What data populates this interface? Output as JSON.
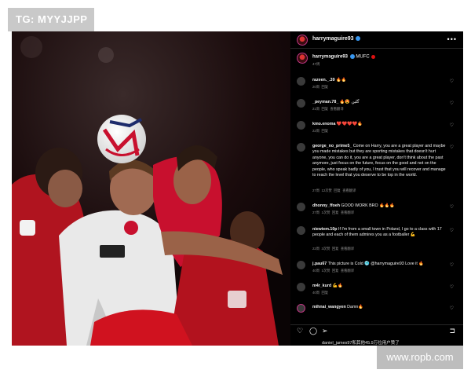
{
  "watermark_top": "TG: MYYJJPP",
  "watermark_bottom": "www.ropb.com",
  "header": {
    "username": "harrymaguire93"
  },
  "caption": {
    "username": "harrymaguire93",
    "text": "MUFC",
    "time": "47周"
  },
  "comments": [
    {
      "username": "razeen._.39",
      "text": "🔥🔥",
      "time": "20周",
      "actions": [
        "回复"
      ]
    },
    {
      "username": "_peyman.78_",
      "text": "🔥😍 گلین",
      "time": "21周",
      "actions": [
        "回复",
        "查看翻译"
      ]
    },
    {
      "username": "kmo.enoma",
      "text": "❤️❤️❤️❤️🔥",
      "time": "22周",
      "actions": [
        "回复"
      ]
    },
    {
      "username": "george_no_prime5_",
      "text": "Come on Harry, you are a great player and maybe you made mistakes but they are sporting mistakes that doesn't hurt anyone, you can do it, you are a great player, don't think about the past anymore, just focus on the future, focus on the good and not on the people, who speak badly of you, I trust that you will recover and manage to reach the level that you deserve to be top in the world.",
      "time": "27周",
      "extra": "12次赞",
      "actions": [
        "回复",
        "查看翻译"
      ]
    },
    {
      "username": "dhonny_ffoeh",
      "text": "GOOD WORK BRO 🔥🔥🔥",
      "time": "27周",
      "extra": "1次赞",
      "actions": [
        "回复",
        "查看翻译"
      ]
    },
    {
      "username": "niewiem.10p",
      "text": "If I'm from a small town in Poland, I go to a class with 17 people and each of them admires you as a footballer 💪",
      "time": "22周",
      "extra": "3次赞",
      "actions": [
        "回复",
        "查看翻译"
      ]
    },
    {
      "username": "j.pau67",
      "text": "This picture is Cold 🥶 @harrymaguire93 Love it 🔥",
      "time": "40周",
      "extra": "1次赞",
      "actions": [
        "回复",
        "查看翻译"
      ]
    },
    {
      "username": "m4r_kurd",
      "text": "💪🔥",
      "time": "40周",
      "actions": [
        "回复"
      ]
    },
    {
      "username": "mihnai_wangyen",
      "text": "Damn🔥",
      "time": "",
      "actions": []
    }
  ],
  "likes_text": "daniel_james97和其他45.9万位用户赞了",
  "icons": [
    "more-icon",
    "heart-icon",
    "comment-icon",
    "share-icon",
    "bookmark-icon",
    "verified-icon"
  ],
  "colors": {
    "background": "#000000",
    "verified": "#3897f0",
    "forest_red": "#c8102e",
    "muted": "#8e8e8e"
  }
}
